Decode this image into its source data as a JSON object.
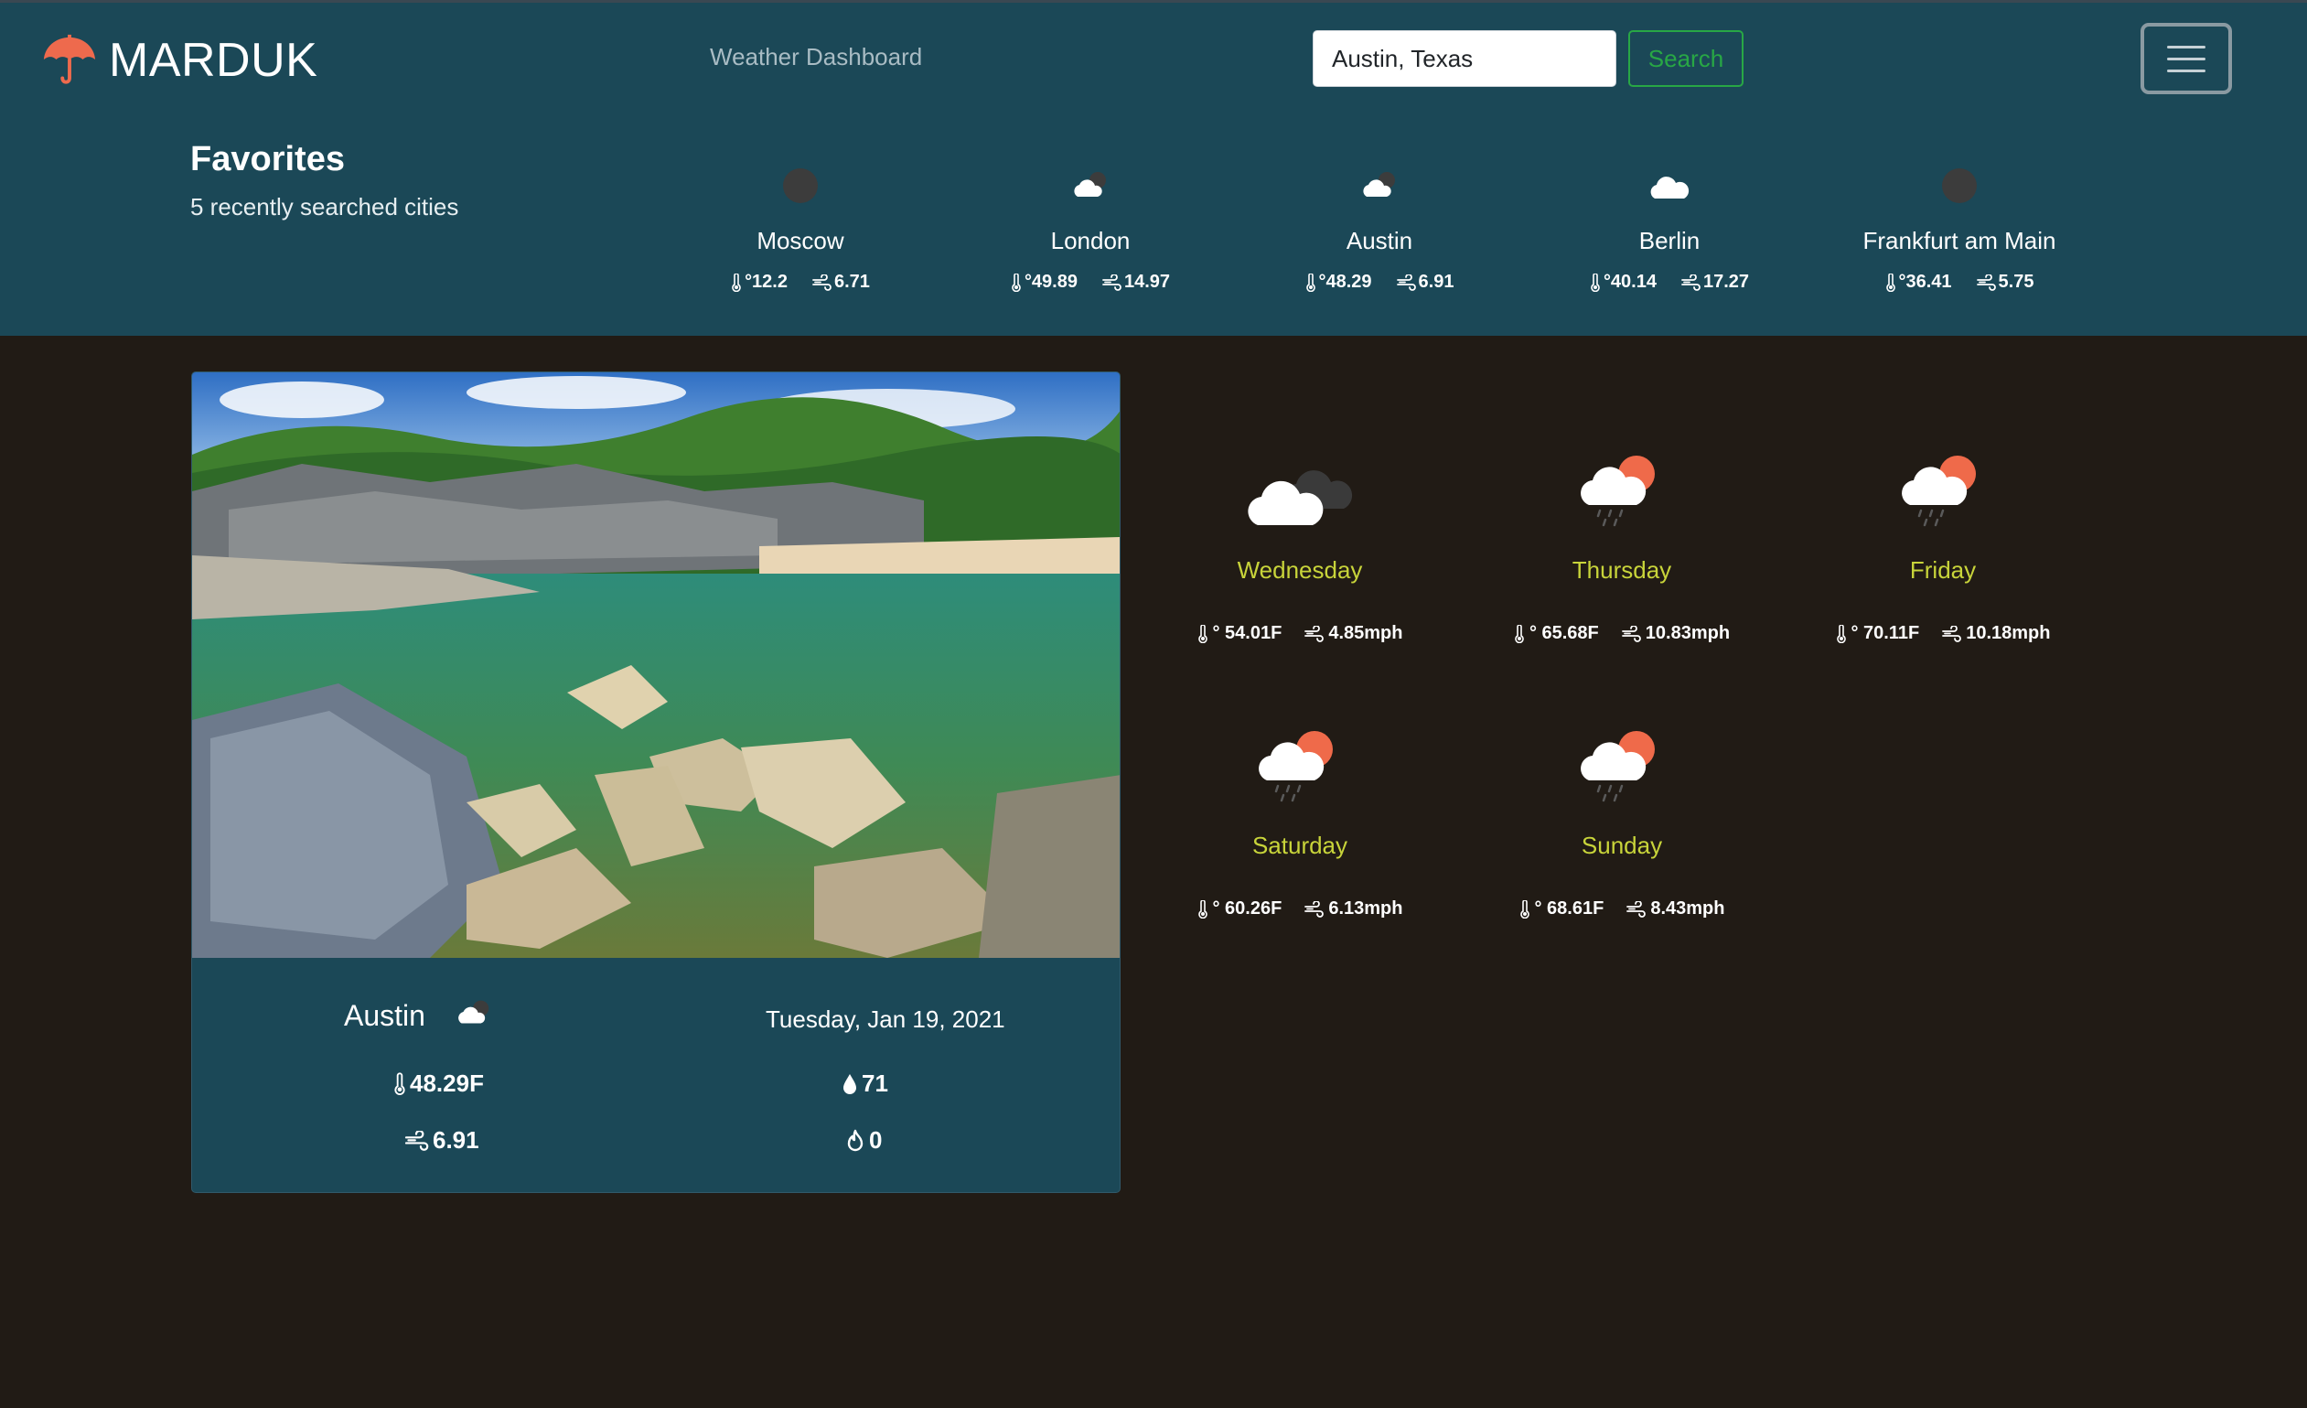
{
  "brand": {
    "name": "MARDUK",
    "icon": "umbrella-icon",
    "color": "#ee6a4d"
  },
  "nav": {
    "link_label": "Weather Dashboard"
  },
  "search": {
    "value": "Austin, Texas",
    "button_label": "Search"
  },
  "favorites": {
    "title": "Favorites",
    "subtitle": "5 recently searched cities",
    "items": [
      {
        "name": "Moscow",
        "icon": "dark-moon-icon",
        "temp": "°12.2",
        "wind": "6.71"
      },
      {
        "name": "London",
        "icon": "cloud-night-icon",
        "temp": "°49.89",
        "wind": "14.97"
      },
      {
        "name": "Austin",
        "icon": "cloud-night-icon",
        "temp": "°48.29",
        "wind": "6.91"
      },
      {
        "name": "Berlin",
        "icon": "cloud-icon",
        "temp": "°40.14",
        "wind": "17.27"
      },
      {
        "name": "Frankfurt am Main",
        "icon": "dark-moon-icon",
        "temp": "°36.41",
        "wind": "5.75"
      }
    ]
  },
  "current": {
    "city": "Austin",
    "icon": "cloud-night-icon",
    "date": "Tuesday, Jan 19, 2021",
    "temp": "48.29F",
    "humidity": "71",
    "wind": "6.91",
    "uv": "0"
  },
  "forecast": [
    {
      "day": "Wednesday",
      "icon": "cloudy-icon",
      "temp": "° 54.01F",
      "wind": "4.85mph"
    },
    {
      "day": "Thursday",
      "icon": "rain-sun-icon",
      "temp": "° 65.68F",
      "wind": "10.83mph"
    },
    {
      "day": "Friday",
      "icon": "rain-sun-icon",
      "temp": "° 70.11F",
      "wind": "10.18mph"
    },
    {
      "day": "Saturday",
      "icon": "rain-sun-icon",
      "temp": "° 60.26F",
      "wind": "6.13mph"
    },
    {
      "day": "Sunday",
      "icon": "rain-sun-icon",
      "temp": "° 68.61F",
      "wind": "8.43mph"
    }
  ],
  "colors": {
    "header_bg": "#1b4857",
    "page_bg": "#211b15",
    "day_label": "#c8d43a",
    "search_button": "#28a745"
  }
}
